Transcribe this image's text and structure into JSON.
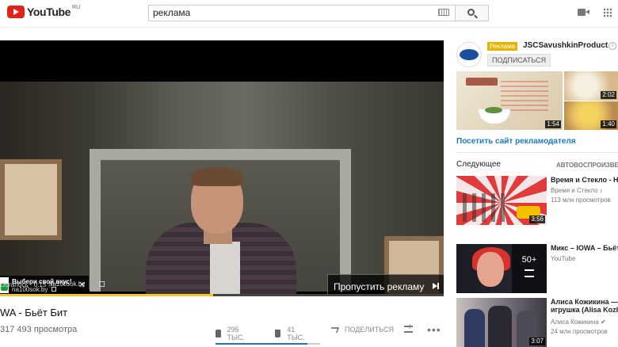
{
  "header": {
    "logo_text": "YouTube",
    "logo_region": "RU",
    "search_value": "реклама"
  },
  "player": {
    "info_card": {
      "title": "Выбери свой вкус!",
      "domain": "na100sok.by",
      "close": "✕"
    },
    "skip_label": "Пропустить рекламу",
    "remaining": "Осталось · 0:15 ⓘ",
    "ad_domain": "na100sok.by",
    "progress_fraction": 0.48
  },
  "video": {
    "title": "WA - Бьёт Бит",
    "views": "317 493 просмотра",
    "likes": "295 ТЫС.",
    "dislikes": "41 ТЫС.",
    "share_label": "ПОДЕЛИТЬСЯ",
    "more": "•••",
    "like_fraction": 0.88
  },
  "sidebar": {
    "ad": {
      "label": "Реклама",
      "channel": "JSCSavushkinProduct",
      "info": "i",
      "subscribe_label": "ПОДПИСАТЬСЯ",
      "thumbs": [
        {
          "duration": "1:54"
        },
        {
          "duration": "2:02"
        },
        {
          "duration": "1:40"
        }
      ],
      "advertiser_link": "Посетить сайт рекламодателя"
    },
    "next_label": "Следующее",
    "autoplay_label": "АВТОВОСПРОИЗВЕДЕНИЕ",
    "recommendations": [
      {
        "title": "Время и Стекло - Н",
        "channel": "Время и Стекло ♪",
        "views": "113 млн просмотров",
        "duration": "3:56"
      },
      {
        "title": "Микс – IOWA – Бьёт",
        "channel": "YouTube",
        "count": "50+"
      },
      {
        "title": "Алиса Кожикина —",
        "title2": "игрушка (Alisa Kozhi",
        "channel": "Алиса Кожикина ✔",
        "views": "24 млн просмотров",
        "duration": "3:07"
      }
    ]
  },
  "colors": {
    "brand_red": "#e62117",
    "link_blue": "#167ac6",
    "ad_yellow": "#e6b300",
    "progress_yellow": "#f3c623"
  }
}
